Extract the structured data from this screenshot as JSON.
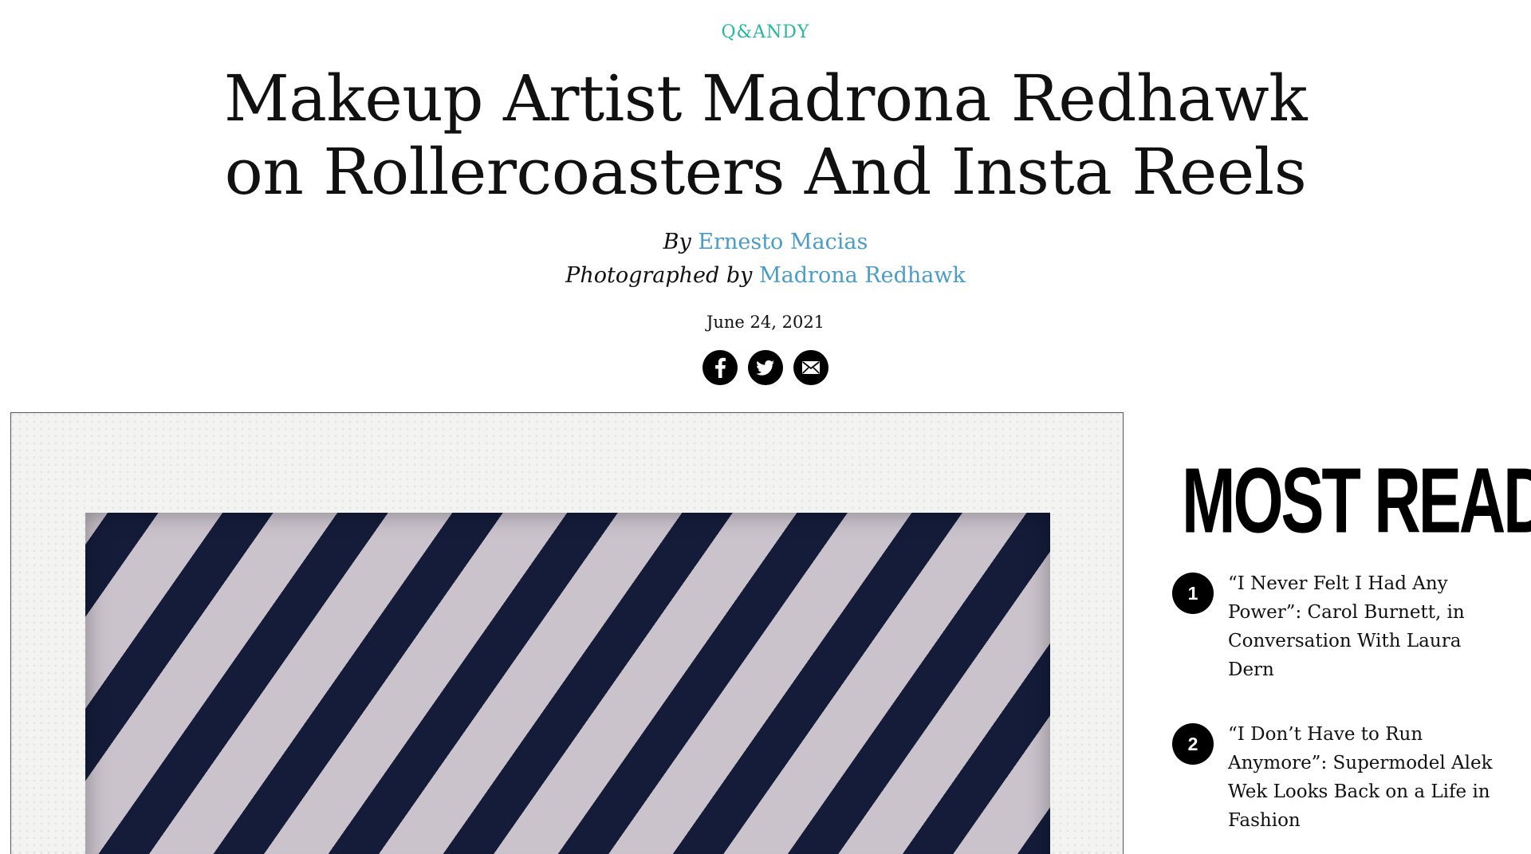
{
  "article": {
    "kicker": "Q&ANDY",
    "title_line1": "Makeup Artist Madrona Redhawk",
    "title_line2": "on Rollercoasters And Insta Reels",
    "by_prefix": "By",
    "author": "Ernesto Macias",
    "photo_prefix": "Photographed by",
    "photographer": "Madrona Redhawk",
    "date": "June 24, 2021"
  },
  "share": {
    "icons": [
      "facebook-icon",
      "twitter-icon",
      "email-icon"
    ]
  },
  "most_read": {
    "heading": "MOST READ",
    "items": [
      {
        "number": "1",
        "title": "“I Never Felt I Had Any Power”: Carol Burnett, in Conversation With Laura Dern"
      },
      {
        "number": "2",
        "title": "“I Don’t Have to Run Anymore”: Supermodel Alek Wek Looks Back on a Life in Fashion"
      }
    ]
  },
  "colors": {
    "accent_kicker": "#25b89c",
    "link": "#4a9cc9",
    "stripe_dark": "#141c3a",
    "stripe_light": "#cbc3cc"
  }
}
